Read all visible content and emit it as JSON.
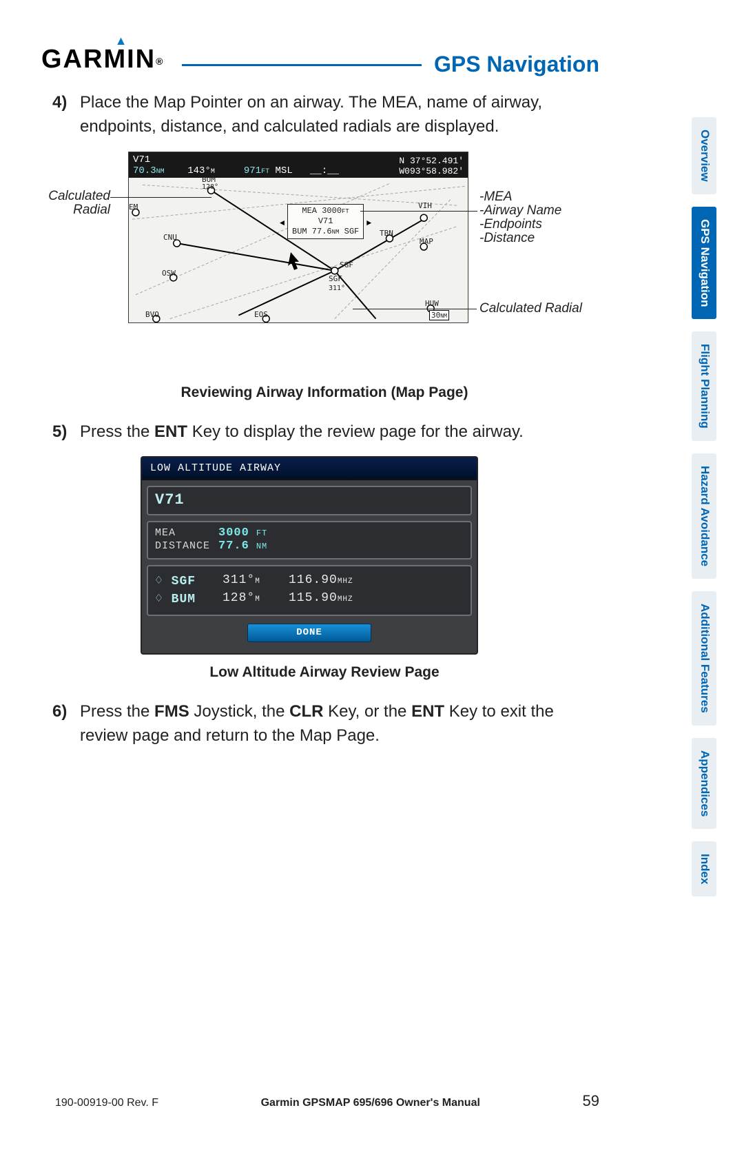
{
  "brand": "GARMIN",
  "section_title": "GPS Navigation",
  "side_tabs": [
    {
      "label": "Overview",
      "active": false
    },
    {
      "label": "GPS Navigation",
      "active": true
    },
    {
      "label": "Flight Planning",
      "active": false
    },
    {
      "label": "Hazard Avoidance",
      "active": false
    },
    {
      "label": "Additional Features",
      "active": false
    },
    {
      "label": "Appendices",
      "active": false
    },
    {
      "label": "Index",
      "active": false
    }
  ],
  "steps": {
    "s4_num": "4)",
    "s4_text": "Place the Map Pointer on an airway.  The MEA, name of airway, endpoints, distance, and calculated radials are displayed.",
    "s5_num": "5)",
    "s5_pre": "Press the ",
    "s5_key": "ENT",
    "s5_post": " Key to display the review page for the airway.",
    "s6_num": "6)",
    "s6_pre": "Press the ",
    "s6_k1": "FMS",
    "s6_mid1": " Joystick, the ",
    "s6_k2": "CLR",
    "s6_mid2": " Key, or the ",
    "s6_k3": "ENT",
    "s6_post": " Key to exit the review page and return to the Map Page."
  },
  "callouts": {
    "calc_radial_left": "Calculated Radial",
    "mea": "-MEA",
    "airway_name": "-Airway Name",
    "endpoints": "-Endpoints",
    "distance": "-Distance",
    "calc_radial_right": "Calculated Radial"
  },
  "map": {
    "top_id": "V71",
    "top_dist": "70.3",
    "top_dist_u": "NM",
    "top_brg": "143°",
    "top_brg_u": "M",
    "top_alt": "971",
    "top_alt_u": "FT",
    "top_msl": "MSL",
    "top_dash": "__:__",
    "lat": "N 37°52.491'",
    "lon": "W093°58.982'",
    "popup_mea": "MEA 3000",
    "popup_mea_u": "FT",
    "popup_id": "V71",
    "popup_dist": "BUM 77.6",
    "popup_dist_u": "NM",
    "popup_end": " SGF",
    "wpt_bum": "BUM",
    "wpt_bum_rad": "128°",
    "wpt_sgf2": "SGF",
    "wpt_sgf2_rad": "311°",
    "wpt_em": "EM",
    "wpt_cnu": "CNU",
    "wpt_osw": "OSW",
    "wpt_bvo": "BVO",
    "wpt_eos": "EOS",
    "wpt_sgf": "SGF",
    "wpt_sge": "SGF",
    "wpt_tbn": "TBN",
    "wpt_vih": "VIH",
    "wpt_map": "MAP",
    "wpt_huw": "HUW",
    "scale": "30",
    "scale_u": "NM"
  },
  "caption1": "Reviewing Airway Information (Map Page)",
  "review": {
    "title": "LOW ALTITUDE AIRWAY",
    "id": "V71",
    "mea_lbl": "MEA",
    "mea_val": "3000",
    "mea_unit": "FT",
    "dist_lbl": "DISTANCE",
    "dist_val": "77.6",
    "dist_unit": "NM",
    "rows": [
      {
        "name": "SGF",
        "radial": "311°",
        "rad_u": "M",
        "freq": "116.90",
        "freq_u": "MHZ"
      },
      {
        "name": "BUM",
        "radial": "128°",
        "rad_u": "M",
        "freq": "115.90",
        "freq_u": "MHZ"
      }
    ],
    "done": "Done"
  },
  "caption2": "Low Altitude Airway Review Page",
  "footer": {
    "docrev": "190-00919-00 Rev. F",
    "center": "Garmin GPSMAP 695/696 Owner's Manual",
    "page": "59"
  }
}
